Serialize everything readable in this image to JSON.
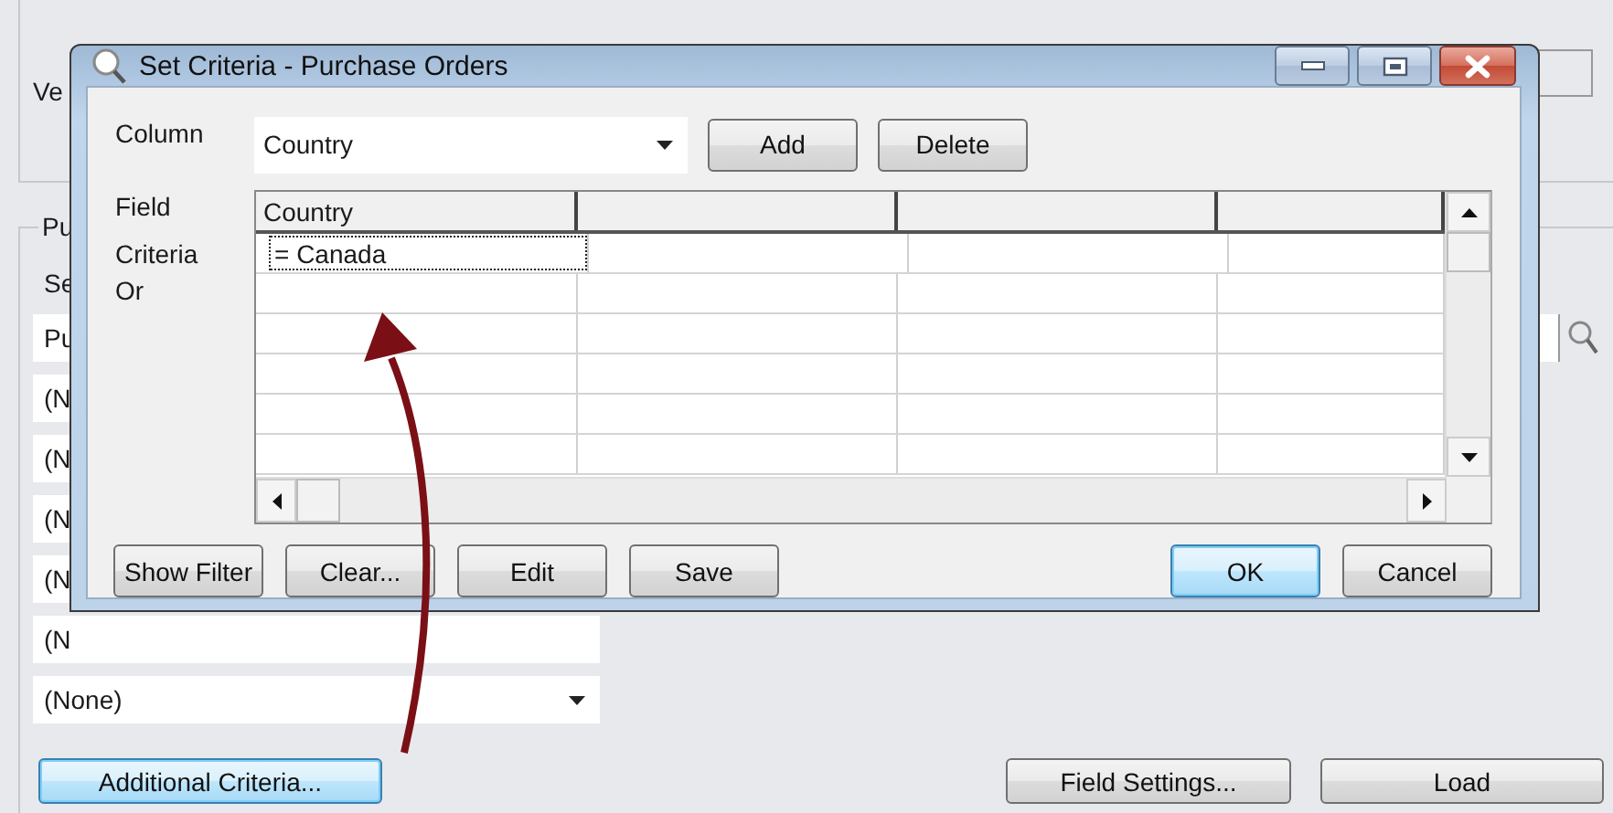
{
  "background_window": {
    "top_label": "Ve",
    "group_label": "Pu",
    "select_label": "Se",
    "search_value": "Pu",
    "filter_values": [
      "(N",
      "(N",
      "(N",
      "(N",
      "(N"
    ],
    "last_filter": "(None)",
    "buttons": [
      {
        "label": "Additional Criteria...",
        "focused": true
      },
      {
        "label": "Field Settings...",
        "focused": false
      },
      {
        "label": "Load",
        "focused": false
      }
    ]
  },
  "dialog": {
    "title": "Set Criteria - Purchase Orders",
    "column_label": "Column",
    "column_value": "Country",
    "top_buttons": [
      {
        "label": "Add",
        "focused": false
      },
      {
        "label": "Delete",
        "focused": false
      }
    ],
    "row_labels": [
      "Field",
      "Criteria",
      "Or"
    ],
    "grid": {
      "columns": [
        {
          "field": "Country",
          "criteria": "= Canada",
          "selected": true
        }
      ]
    },
    "bottom_left_buttons": [
      {
        "label": "Show Filter",
        "focused": false
      },
      {
        "label": "Clear...",
        "focused": false
      },
      {
        "label": "Edit",
        "focused": false
      },
      {
        "label": "Save",
        "focused": false
      }
    ],
    "bottom_right_buttons": [
      {
        "label": "OK",
        "focused": true
      },
      {
        "label": "Cancel",
        "focused": false
      }
    ]
  }
}
